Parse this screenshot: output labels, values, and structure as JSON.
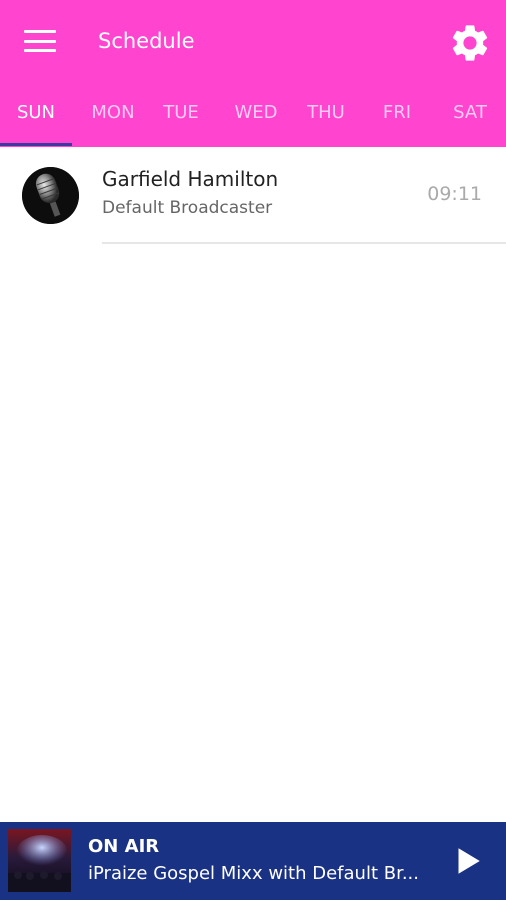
{
  "header": {
    "title": "Schedule",
    "menu_icon": "hamburger-menu-icon",
    "settings_icon": "gear-icon",
    "color": "#ff44cf"
  },
  "tabs": [
    {
      "label": "SUN",
      "active": true
    },
    {
      "label": "MON",
      "active": false
    },
    {
      "label": "TUE",
      "active": false
    },
    {
      "label": "WED",
      "active": false
    },
    {
      "label": "THU",
      "active": false
    },
    {
      "label": "FRI",
      "active": false
    },
    {
      "label": "SAT",
      "active": false
    }
  ],
  "schedule": [
    {
      "host": "Garfield Hamilton",
      "subtitle": "Default Broadcaster",
      "time": "09:11",
      "avatar_icon": "microphone-icon"
    }
  ],
  "player": {
    "status": "ON AIR",
    "track": "iPraize Gospel Mixx with Default Br...",
    "play_icon": "play-icon",
    "color": "#1a3283"
  }
}
